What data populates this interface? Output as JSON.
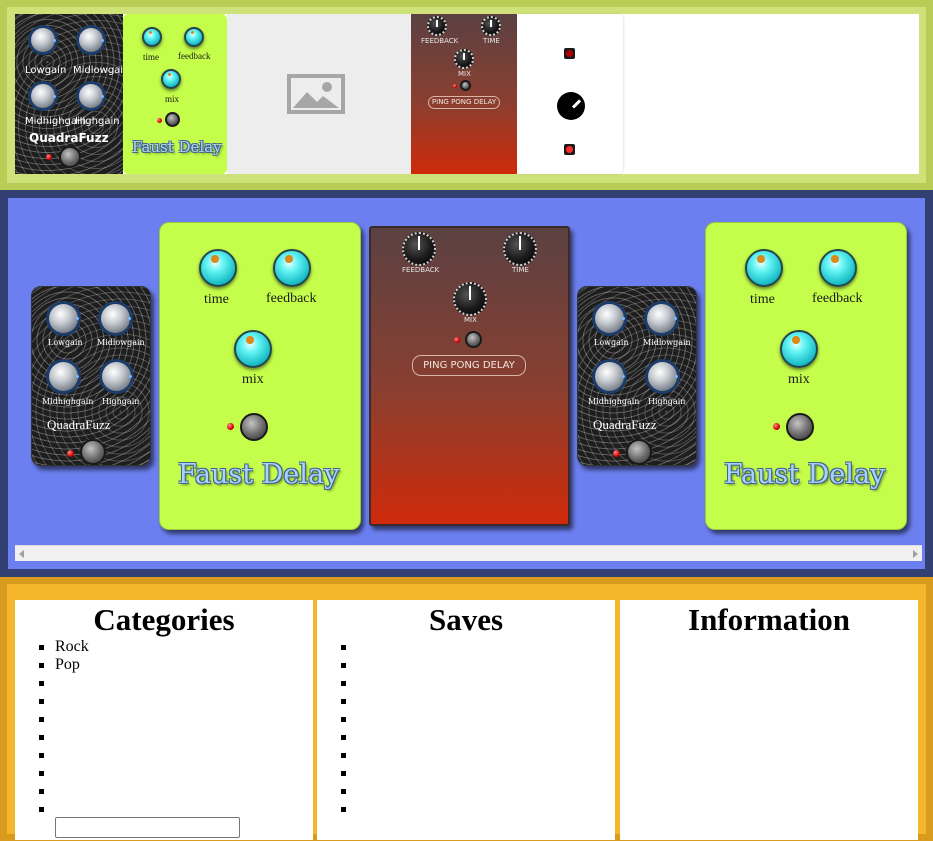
{
  "top_strip": {
    "quadrafuzz": {
      "knob_labels": [
        "Lowgain",
        "Midlowgain",
        "Midhighgain",
        "Highgain"
      ],
      "title": "QuadraFuzz"
    },
    "faust_delay": {
      "knob_labels": [
        "time",
        "feedback",
        "mix"
      ],
      "title": "Faust Delay"
    },
    "placeholder": {
      "icon": "image-placeholder-icon"
    },
    "ping_pong": {
      "knob_labels": [
        "FEEDBACK",
        "TIME",
        "MIX"
      ],
      "title": "PING PONG DELAY"
    },
    "mini_plugin": {
      "icon": "knob-icon"
    }
  },
  "rack": {
    "quadrafuzz_1": {
      "knob_labels": [
        "Lowgain",
        "Midlowgain",
        "Midhighgain",
        "Highgain"
      ],
      "title": "QuadraFuzz"
    },
    "faust_delay_1": {
      "knob_labels": [
        "time",
        "feedback",
        "mix"
      ],
      "title": "Faust Delay"
    },
    "ping_pong": {
      "knob_labels": [
        "FEEDBACK",
        "TIME",
        "MIX"
      ],
      "title": "PING PONG DELAY"
    },
    "quadrafuzz_2": {
      "knob_labels": [
        "Lowgain",
        "Midlowgain",
        "Midhighgain",
        "Highgain"
      ],
      "title": "QuadraFuzz"
    },
    "faust_delay_2": {
      "knob_labels": [
        "time",
        "feedback",
        "mix"
      ],
      "title": "Faust Delay"
    }
  },
  "bottom": {
    "categories": {
      "heading": "Categories",
      "items": [
        "Rock",
        "Pop",
        "",
        "",
        "",
        "",
        "",
        "",
        "",
        ""
      ],
      "input_value": ""
    },
    "saves": {
      "heading": "Saves",
      "items": [
        "",
        "",
        "",
        "",
        "",
        "",
        "",
        "",
        "",
        ""
      ]
    },
    "information": {
      "heading": "Information"
    }
  },
  "colors": {
    "top_strip_bg": "#cfe27a",
    "rack_bg": "#6b7ff0",
    "rack_border": "#313f72",
    "bottom_bg": "#f6b62c",
    "faust_delay_bg": "#c4fd4a",
    "ping_pong_bottom": "#cf2a0a"
  }
}
